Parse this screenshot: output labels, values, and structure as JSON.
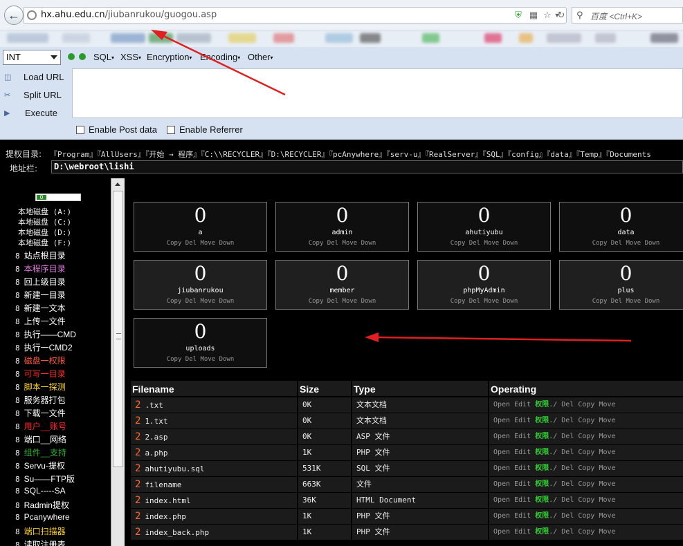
{
  "browser": {
    "url_host": "hx.ahu.edu.cn",
    "url_path": "/jiubanrukou/guogou.asp",
    "search_placeholder": "百度 <Ctrl+K>"
  },
  "hackbar": {
    "type_select": "INT",
    "menus": [
      "SQL",
      "XSS",
      "Encryption",
      "Encoding",
      "Other"
    ],
    "side_buttons": [
      "Load URL",
      "Split URL",
      "Execute"
    ],
    "checks": [
      "Enable Post data",
      "Enable Referrer"
    ]
  },
  "shell": {
    "priv_label": "提权目录:",
    "priv_paths": "『Program』『AllUsers』『开始 → 程序』『C:\\\\RECYCLER』『D:\\RECYCLER』『pcAnywhere』『serv-u』『RealServer』『SQL』『config』『data』『Temp』『Documents",
    "addr_label": "地址栏:",
    "addr_value": "D:\\webroot\\lishi",
    "meter_value": "0",
    "drives": [
      "本地磁盘 (A:)",
      "本地磁盘 (C:)",
      "本地磁盘 (D:)",
      "本地磁盘 (F:)"
    ],
    "nav": [
      {
        "num": "8",
        "label": "站点根目录",
        "color": "#ffffff"
      },
      {
        "num": "8",
        "label": "本程序目录",
        "color": "#e07be0"
      },
      {
        "num": "8",
        "label": "回上级目录",
        "color": "#ffffff"
      },
      {
        "num": "8",
        "label": "新建一目录",
        "color": "#ffffff"
      },
      {
        "num": "8",
        "label": "新建一文本",
        "color": "#ffffff"
      },
      {
        "num": "8",
        "label": "上传一文件",
        "color": "#ffffff"
      },
      {
        "num": "8",
        "label": "执行——CMD",
        "color": "#ffffff"
      },
      {
        "num": "8",
        "label": "执行一CMD2",
        "color": "#ffffff"
      },
      {
        "num": "8",
        "label": "磁盘一权限",
        "color": "#ff5a3c"
      },
      {
        "num": "8",
        "label": "可写一目录",
        "color": "#ff2a2a"
      },
      {
        "num": "8",
        "label": "脚本一探测",
        "color": "#ffd21f"
      },
      {
        "num": "8",
        "label": "服务器打包",
        "color": "#ffffff"
      },
      {
        "num": "8",
        "label": "下载一文件",
        "color": "#ffffff"
      },
      {
        "num": "8",
        "label": "用户__账号",
        "color": "#ff2a2a"
      },
      {
        "num": "8",
        "label": "端口__网络",
        "color": "#ffffff"
      },
      {
        "num": "8",
        "label": "组件__支持",
        "color": "#2fb12f"
      },
      {
        "num": "8",
        "label": "Servu-提权",
        "color": "#ffffff"
      },
      {
        "num": "8",
        "label": "Su——FTP版",
        "color": "#ffffff"
      },
      {
        "num": "8",
        "label": "SQL-----SA",
        "color": "#ffffff"
      },
      {
        "num": "8",
        "label": "Radmin提权",
        "color": "#ffffff"
      },
      {
        "num": "8",
        "label": "Pcanywhere",
        "color": "#ffffff"
      },
      {
        "num": "8",
        "label": "端口扫描器",
        "color": "#ffd21f"
      },
      {
        "num": "8",
        "label": "读取注册表",
        "color": "#ffffff"
      }
    ],
    "folder_actions": "Copy Del Move Down",
    "folders": [
      {
        "count": "0",
        "name": "a"
      },
      {
        "count": "0",
        "name": "admin"
      },
      {
        "count": "0",
        "name": "ahutiyubu"
      },
      {
        "count": "0",
        "name": "data"
      },
      {
        "count": "0",
        "name": "jiubanrukou"
      },
      {
        "count": "0",
        "name": "member"
      },
      {
        "count": "0",
        "name": "phpMyAdmin"
      },
      {
        "count": "0",
        "name": "plus"
      },
      {
        "count": "0",
        "name": "uploads"
      }
    ],
    "table_headers": [
      "Filename",
      "Size",
      "Type",
      "Operating"
    ],
    "op_pre": "Open Edit",
    "op_perm": "权限",
    "op_post": "./ Del Copy Move",
    "row_icon": "2",
    "files": [
      {
        "name": ".txt",
        "size": "0K",
        "type": "文本文档"
      },
      {
        "name": "1.txt",
        "size": "0K",
        "type": "文本文档"
      },
      {
        "name": "2.asp",
        "size": "0K",
        "type": "ASP 文件"
      },
      {
        "name": "a.php",
        "size": "1K",
        "type": "PHP 文件"
      },
      {
        "name": "ahutiyubu.sql",
        "size": "531K",
        "type": "SQL 文件"
      },
      {
        "name": "filename",
        "size": "663K",
        "type": "文件"
      },
      {
        "name": "index.html",
        "size": "36K",
        "type": "HTML Document"
      },
      {
        "name": "index.php",
        "size": "1K",
        "type": "PHP 文件"
      },
      {
        "name": "index_back.php",
        "size": "1K",
        "type": "PHP 文件"
      }
    ]
  }
}
